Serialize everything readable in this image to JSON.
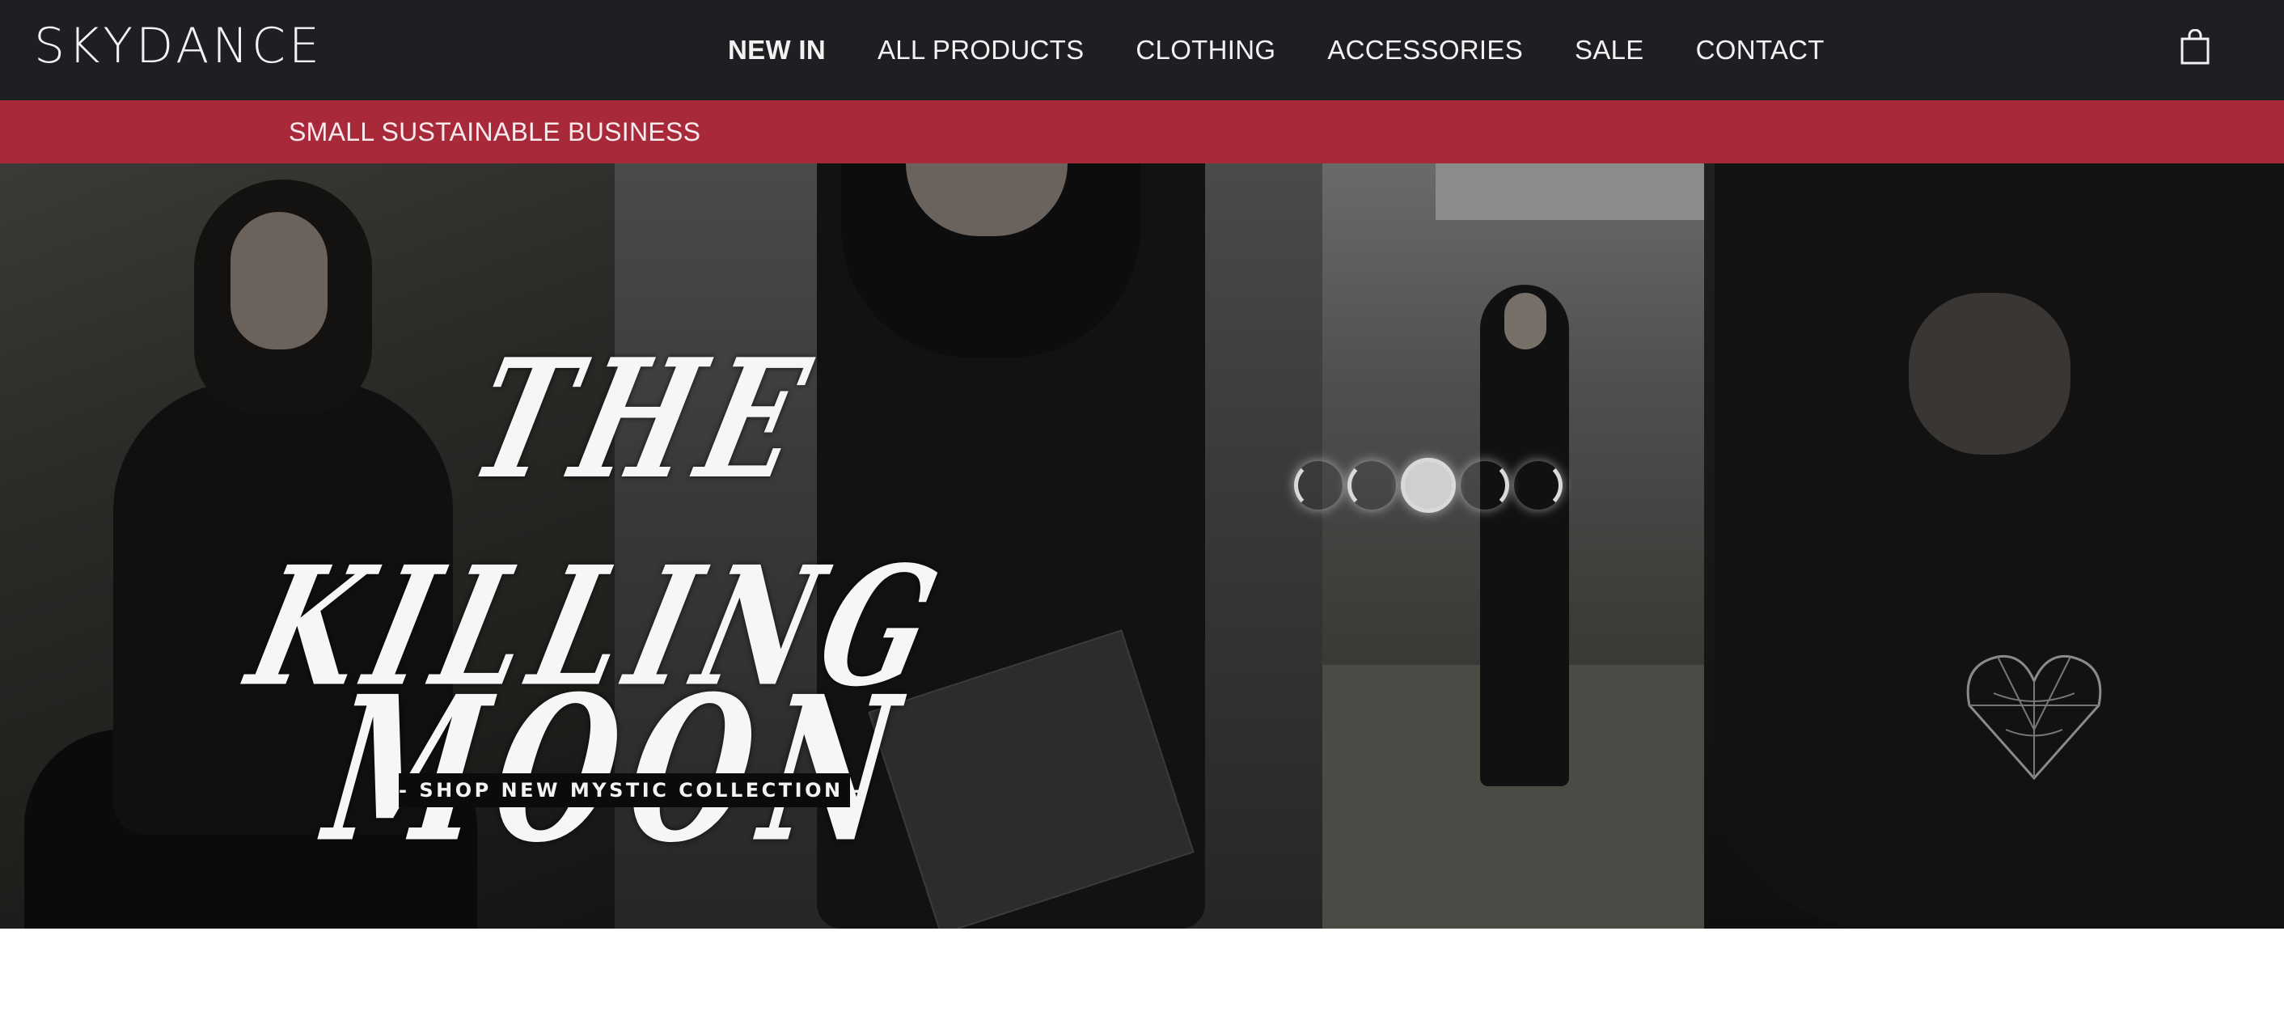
{
  "header": {
    "logo_text": "SKYDANCE",
    "nav": [
      {
        "label": "NEW IN",
        "active": true
      },
      {
        "label": "ALL PRODUCTS",
        "active": false
      },
      {
        "label": "CLOTHING",
        "active": false
      },
      {
        "label": "ACCESSORIES",
        "active": false
      },
      {
        "label": "SALE",
        "active": false
      },
      {
        "label": "CONTACT",
        "active": false
      }
    ],
    "cart_icon": "shopping-bag-icon"
  },
  "promo_bar": {
    "text": "SMALL SUSTAINABLE BUSINESS"
  },
  "hero": {
    "headline_line1": "THE KILLING",
    "headline_line2": "MOON",
    "cta_label": "- SHOP NEW MYSTIC COLLECTION -"
  },
  "colors": {
    "header_bg": "#1e1f22",
    "promo_bg": "#a82a3a",
    "text_light": "#f2f2f2"
  }
}
